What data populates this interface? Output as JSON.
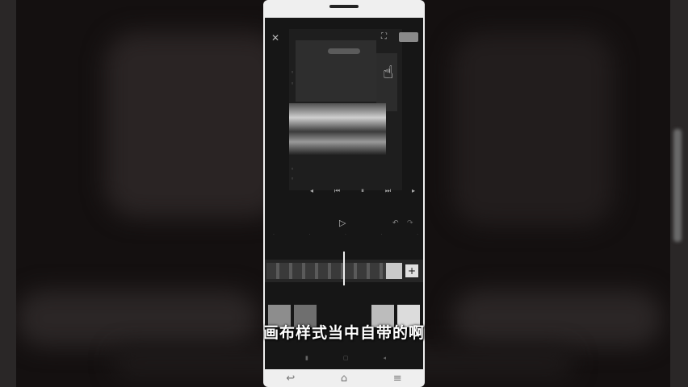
{
  "editor": {
    "close_icon": "✕",
    "expand_icon": "⛶",
    "export_label": "",
    "caption": "",
    "time": "",
    "play_icon": "▷",
    "undo_icon": "↶",
    "redo_icon": "↷",
    "transport": [
      "◂",
      "⏮",
      "⏸",
      "⏭",
      "▸"
    ],
    "canvas_style_label": ""
  },
  "subtitle": "画布样式当中自带的啊",
  "device_nav": {
    "back_icon": "↩",
    "home_icon": "⌂",
    "menu_icon": "≡"
  }
}
